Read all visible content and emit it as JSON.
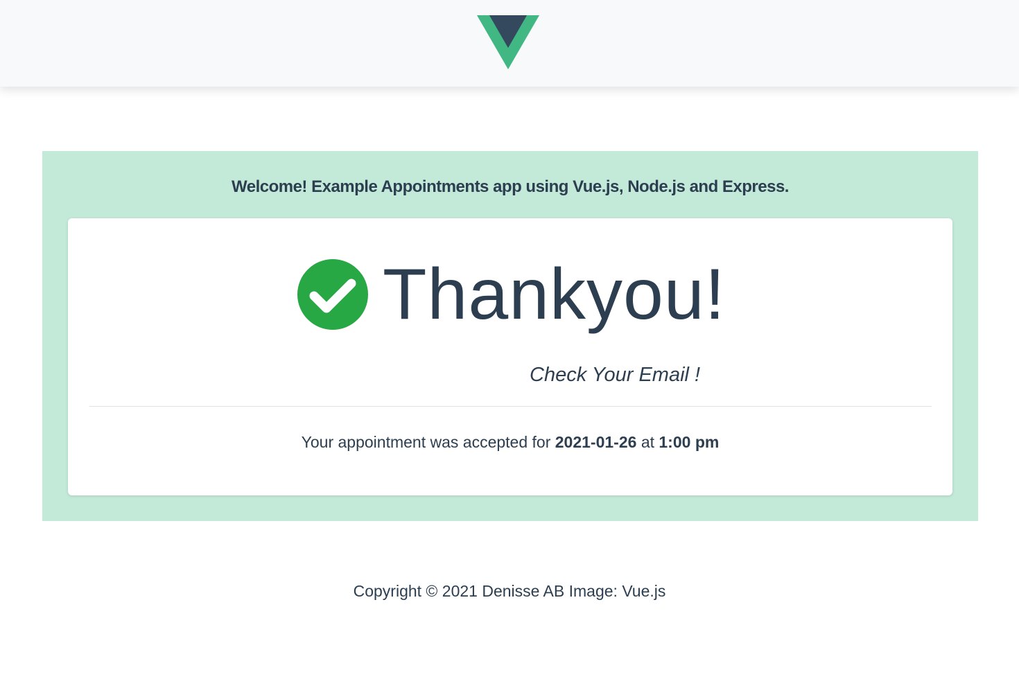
{
  "header": {
    "logo_icon": "vue-logo-icon",
    "logo_colors": {
      "outer": "#41b883",
      "inner": "#35495e"
    }
  },
  "banner": {
    "background": "#c3e9d8",
    "welcome_text": "Welcome! Example Appointments app using Vue.js, Node.js and Express."
  },
  "card": {
    "check_icon": "check-circle-icon",
    "check_color": "#28a745",
    "title": "Thankyou!",
    "subtitle": "Check Your Email !",
    "appointment_prefix": "Your appointment was accepted for",
    "appointment_date": "2021-01-26",
    "appointment_connector": "at",
    "appointment_time": "1:00 pm"
  },
  "footer": {
    "text": "Copyright © 2021 Denisse AB Image: Vue.js"
  }
}
